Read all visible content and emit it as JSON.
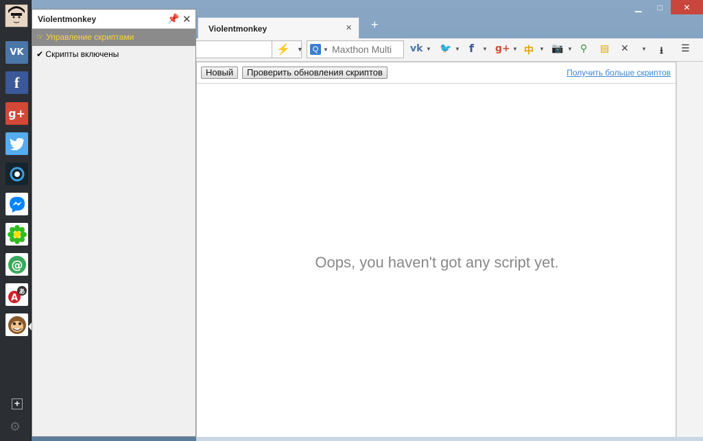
{
  "panel": {
    "title": "Violentmonkey",
    "menu": [
      {
        "label": "Управление скриптами",
        "active": true
      },
      {
        "label": "Скрипты включены",
        "active": false
      }
    ]
  },
  "sidebar": {
    "items": [
      {
        "name": "vk",
        "glyph": "VK",
        "bg": "#4a76a8"
      },
      {
        "name": "facebook",
        "glyph": "f",
        "bg": "#3b5998"
      },
      {
        "name": "google-plus",
        "glyph": "g+",
        "bg": "#d34836"
      },
      {
        "name": "twitter",
        "glyph": "🐦",
        "bg": "#55acee"
      },
      {
        "name": "skype-like",
        "glyph": "◐",
        "bg": "#1b1b1b"
      },
      {
        "name": "messenger",
        "glyph": "⚡",
        "bg": "#0084ff"
      },
      {
        "name": "icq",
        "glyph": "✿",
        "bg": "#22aa22"
      },
      {
        "name": "mail-agent",
        "glyph": "@",
        "bg": "#3aa85b"
      },
      {
        "name": "translator",
        "glyph": "A",
        "bg": "#d0202a"
      },
      {
        "name": "violentmonkey",
        "glyph": "🐵",
        "bg": "#c58a3c"
      }
    ],
    "add": "+",
    "settings": "⚙"
  },
  "tabs": [
    {
      "title": "Violentmonkey",
      "close": "×"
    }
  ],
  "new_tab": "+",
  "search": {
    "placeholder": "Maxthon Multi"
  },
  "page": {
    "new_button": "Новый",
    "check_updates_button": "Проверить обновления скриптов",
    "more_scripts_link": "Получить больше скриптов",
    "empty_message": "Oops, you haven't got any script yet."
  },
  "window_controls": {
    "minimize": "▁",
    "maximize": "□",
    "close": "✕"
  }
}
